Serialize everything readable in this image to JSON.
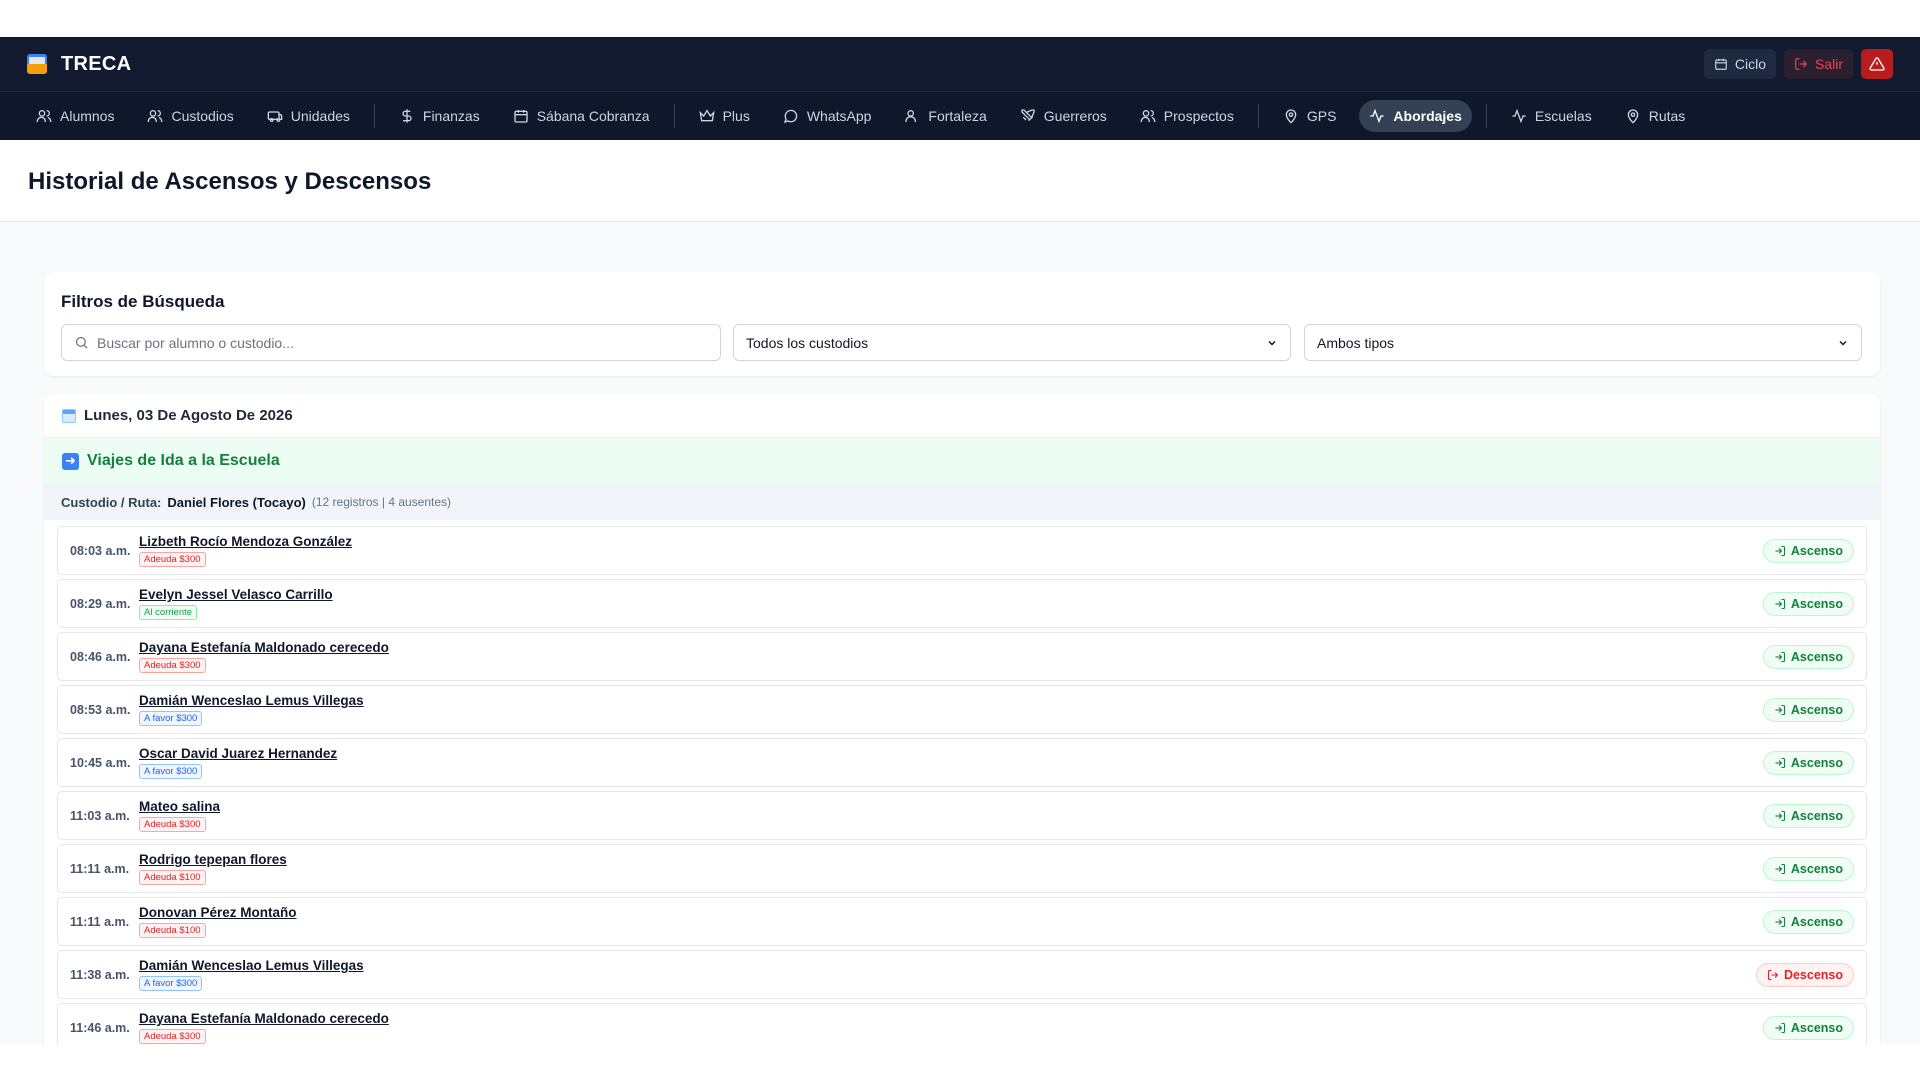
{
  "app": {
    "name": "TRECA"
  },
  "topbar": {
    "ciclo_label": "Ciclo",
    "salir_label": "Salir"
  },
  "nav": [
    {
      "label": "Alumnos",
      "icon": "users-icon"
    },
    {
      "label": "Custodios",
      "icon": "users-icon"
    },
    {
      "label": "Unidades",
      "icon": "bus-icon"
    },
    {
      "label": "Finanzas",
      "icon": "dollar-icon"
    },
    {
      "label": "Sábana Cobranza",
      "icon": "calendar-icon"
    },
    {
      "label": "Plus",
      "icon": "crown-icon"
    },
    {
      "label": "WhatsApp",
      "icon": "chat-icon"
    },
    {
      "label": "Fortaleza",
      "icon": "user-icon"
    },
    {
      "label": "Guerreros",
      "icon": "swords-icon"
    },
    {
      "label": "Prospectos",
      "icon": "users-icon"
    },
    {
      "label": "GPS",
      "icon": "map-pin-icon"
    },
    {
      "label": "Abordajes",
      "icon": "activity-icon",
      "active": true
    },
    {
      "label": "Escuelas",
      "icon": "activity-icon"
    },
    {
      "label": "Rutas",
      "icon": "map-pin-icon"
    }
  ],
  "page": {
    "title": "Historial de Ascensos y Descensos"
  },
  "filters": {
    "title": "Filtros de Búsqueda",
    "search_placeholder": "Buscar por alumno o custodio...",
    "custodio_selected": "Todos los custodios",
    "tipo_selected": "Ambos tipos"
  },
  "day": {
    "date_label": "Lunes, 03 De Agosto De 2026",
    "trip_label": "Viajes de Ida a la Escuela",
    "route_label": "Custodio / Ruta:",
    "route_name": "Daniel Flores (Tocayo)",
    "route_meta": "(12 registros | 4 ausentes)",
    "records": [
      {
        "time": "08:03 a.m.",
        "student": "Lizbeth Rocío Mendoza González",
        "badge": "Adeuda $300",
        "badge_kind": "debt",
        "type": "Ascenso",
        "type_kind": "up"
      },
      {
        "time": "08:29 a.m.",
        "student": "Evelyn Jessel Velasco Carrillo",
        "badge": "Al corriente",
        "badge_kind": "ok",
        "type": "Ascenso",
        "type_kind": "up"
      },
      {
        "time": "08:46 a.m.",
        "student": "Dayana Estefanía Maldonado cerecedo",
        "badge": "Adeuda $300",
        "badge_kind": "debt",
        "type": "Ascenso",
        "type_kind": "up"
      },
      {
        "time": "08:53 a.m.",
        "student": "Damián Wenceslao Lemus Villegas",
        "badge": "A favor $300",
        "badge_kind": "fav",
        "type": "Ascenso",
        "type_kind": "up"
      },
      {
        "time": "10:45 a.m.",
        "student": "Oscar David Juarez Hernandez",
        "badge": "A favor $300",
        "badge_kind": "fav",
        "type": "Ascenso",
        "type_kind": "up"
      },
      {
        "time": "11:03 a.m.",
        "student": "Mateo salina",
        "badge": "Adeuda $300",
        "badge_kind": "debt",
        "type": "Ascenso",
        "type_kind": "up"
      },
      {
        "time": "11:11 a.m.",
        "student": "Rodrigo tepepan flores",
        "badge": "Adeuda $100",
        "badge_kind": "debt",
        "type": "Ascenso",
        "type_kind": "up"
      },
      {
        "time": "11:11 a.m.",
        "student": "Donovan Pérez Montaño",
        "badge": "Adeuda $100",
        "badge_kind": "debt",
        "type": "Ascenso",
        "type_kind": "up"
      },
      {
        "time": "11:38 a.m.",
        "student": "Damián Wenceslao Lemus Villegas",
        "badge": "A favor $300",
        "badge_kind": "fav",
        "type": "Descenso",
        "type_kind": "down"
      },
      {
        "time": "11:46 a.m.",
        "student": "Dayana Estefanía Maldonado cerecedo",
        "badge": "Adeuda $300",
        "badge_kind": "debt",
        "type": "Ascenso",
        "type_kind": "up"
      }
    ]
  },
  "colors": {
    "topbar_bg": "#111a2e",
    "nav_bg": "#0f172a",
    "ascenso": "#15803d",
    "descenso": "#dc2626",
    "trip_bg": "#ecfdf3"
  }
}
